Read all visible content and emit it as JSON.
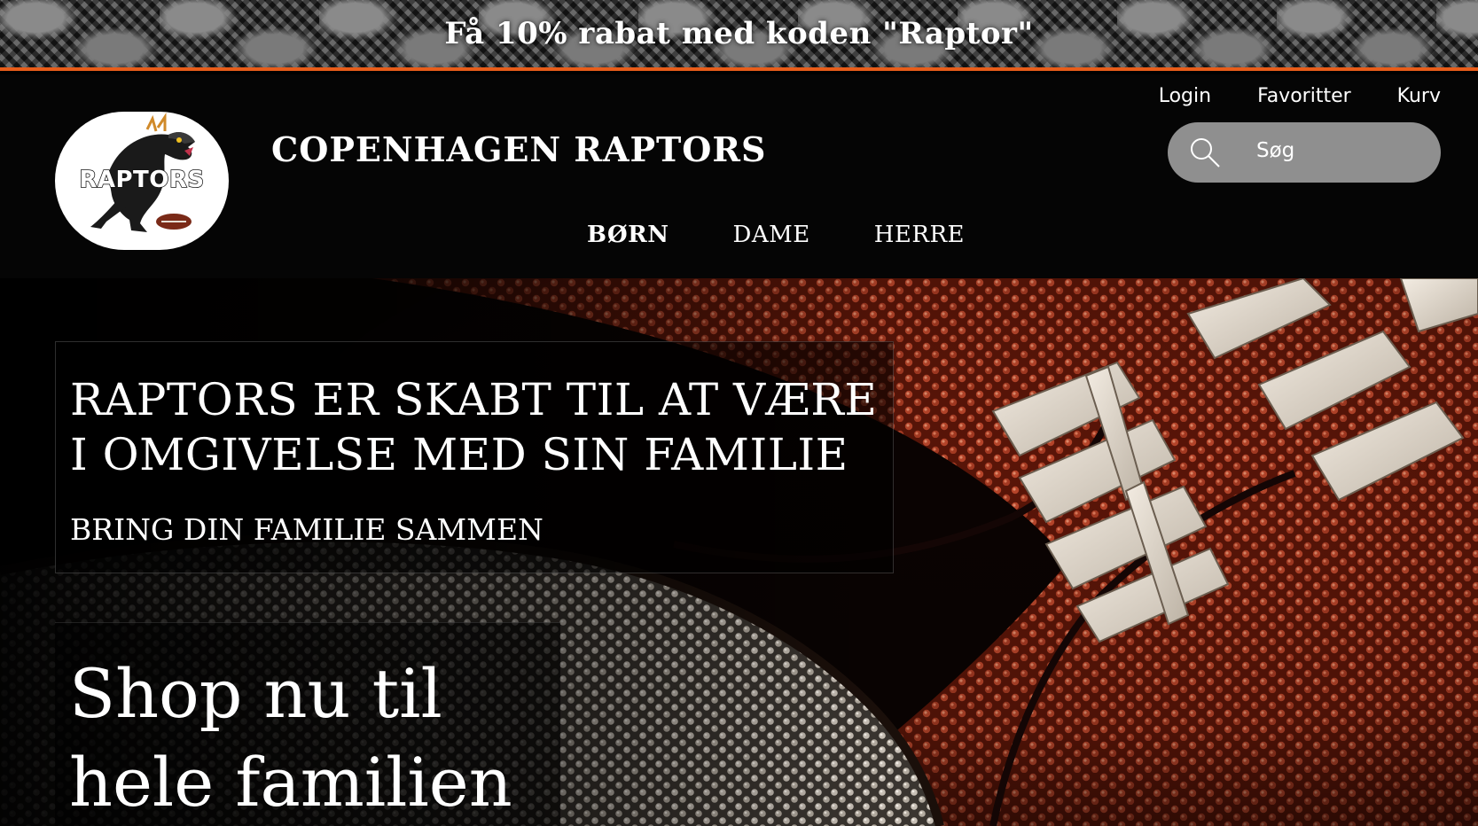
{
  "promo": {
    "text": "Få 10% rabat med koden \"Raptor\""
  },
  "header": {
    "logo_text": "RAPTORS",
    "brand_title": "COPENHAGEN RAPTORS",
    "util_links": {
      "login": "Login",
      "favorites": "Favoritter",
      "cart": "Kurv"
    },
    "search": {
      "placeholder": "Søg",
      "icon": "search-icon"
    },
    "nav": {
      "kids": "BØRN",
      "women": "DAME",
      "men": "HERRE",
      "active": "BØRN"
    }
  },
  "hero": {
    "heading_line1": "RAPTORS ER SKABT TIL AT VÆRE",
    "heading_line2": "I OMGIVELSE MED SIN FAMILIE",
    "subheading": "BRING DIN FAMILIE SAMMEN",
    "cta_line1": "Shop nu til",
    "cta_line2": "hele familien"
  },
  "colors": {
    "accent": "#e85d1a",
    "header_bg": "#050505",
    "search_bg": "#8f8f8f",
    "ball_leather": "#8a2a14",
    "laces": "#e6ded4"
  }
}
